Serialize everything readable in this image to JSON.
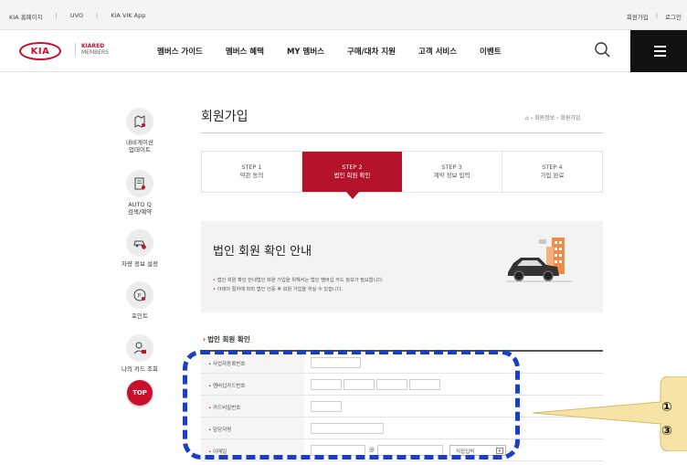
{
  "topbar": {
    "links": [
      "KIA 홈페이지",
      "UVO",
      "KIA VIK App"
    ],
    "separator": "|",
    "right_links": [
      "회원가입",
      "로그인"
    ]
  },
  "header": {
    "logo": "KIA",
    "brand_line1": "KIARED",
    "brand_line2": "MEMBERS",
    "nav": [
      "멤버스 가이드",
      "멤버스 혜택",
      "MY 멤버스",
      "구매/대차 지원",
      "고객 서비스",
      "이벤트"
    ]
  },
  "quick_menu": {
    "items": [
      "내비게이션\n업데이트",
      "AUTO Q\n검색/예약",
      "차량 정보 설정",
      "포인트",
      "나의 카드 조회"
    ],
    "top_label": "TOP"
  },
  "page": {
    "title": "회원가입",
    "breadcrumb": "⌂ › 회원정보 › 회원가입"
  },
  "steps": [
    {
      "num": "STEP 1",
      "label": "약관 동의"
    },
    {
      "num": "STEP 2",
      "label": "법인 회원 확인"
    },
    {
      "num": "STEP 3",
      "label": "계약 정보 입력"
    },
    {
      "num": "STEP 4",
      "label": "가입 완료"
    }
  ],
  "active_step": 2,
  "info": {
    "heading": "법인 회원 확인 안내",
    "lines": [
      "법인 회원 확인 안내법인 회원 가입을 위해서는 법인 멤버십 카드 정보가 필요합니다.",
      "아래의 절차에 따라 법인 인증 후 회원 가입을 하실 수 있습니다."
    ]
  },
  "form": {
    "section_title": "법인 회원 확인",
    "fields": [
      "사업자등록번호",
      "멤버십카드번호",
      "카드비밀번호",
      "담당자명",
      "이메일"
    ],
    "email_at": "@",
    "email_select": "직접입력"
  },
  "annotation": {
    "line1": "①",
    "line2": "③"
  },
  "colors": {
    "brand": "#c8102e",
    "active_step": "#b3132b",
    "dashed_annotation": "#1a3fc2",
    "callout": "#f6e3a6"
  }
}
